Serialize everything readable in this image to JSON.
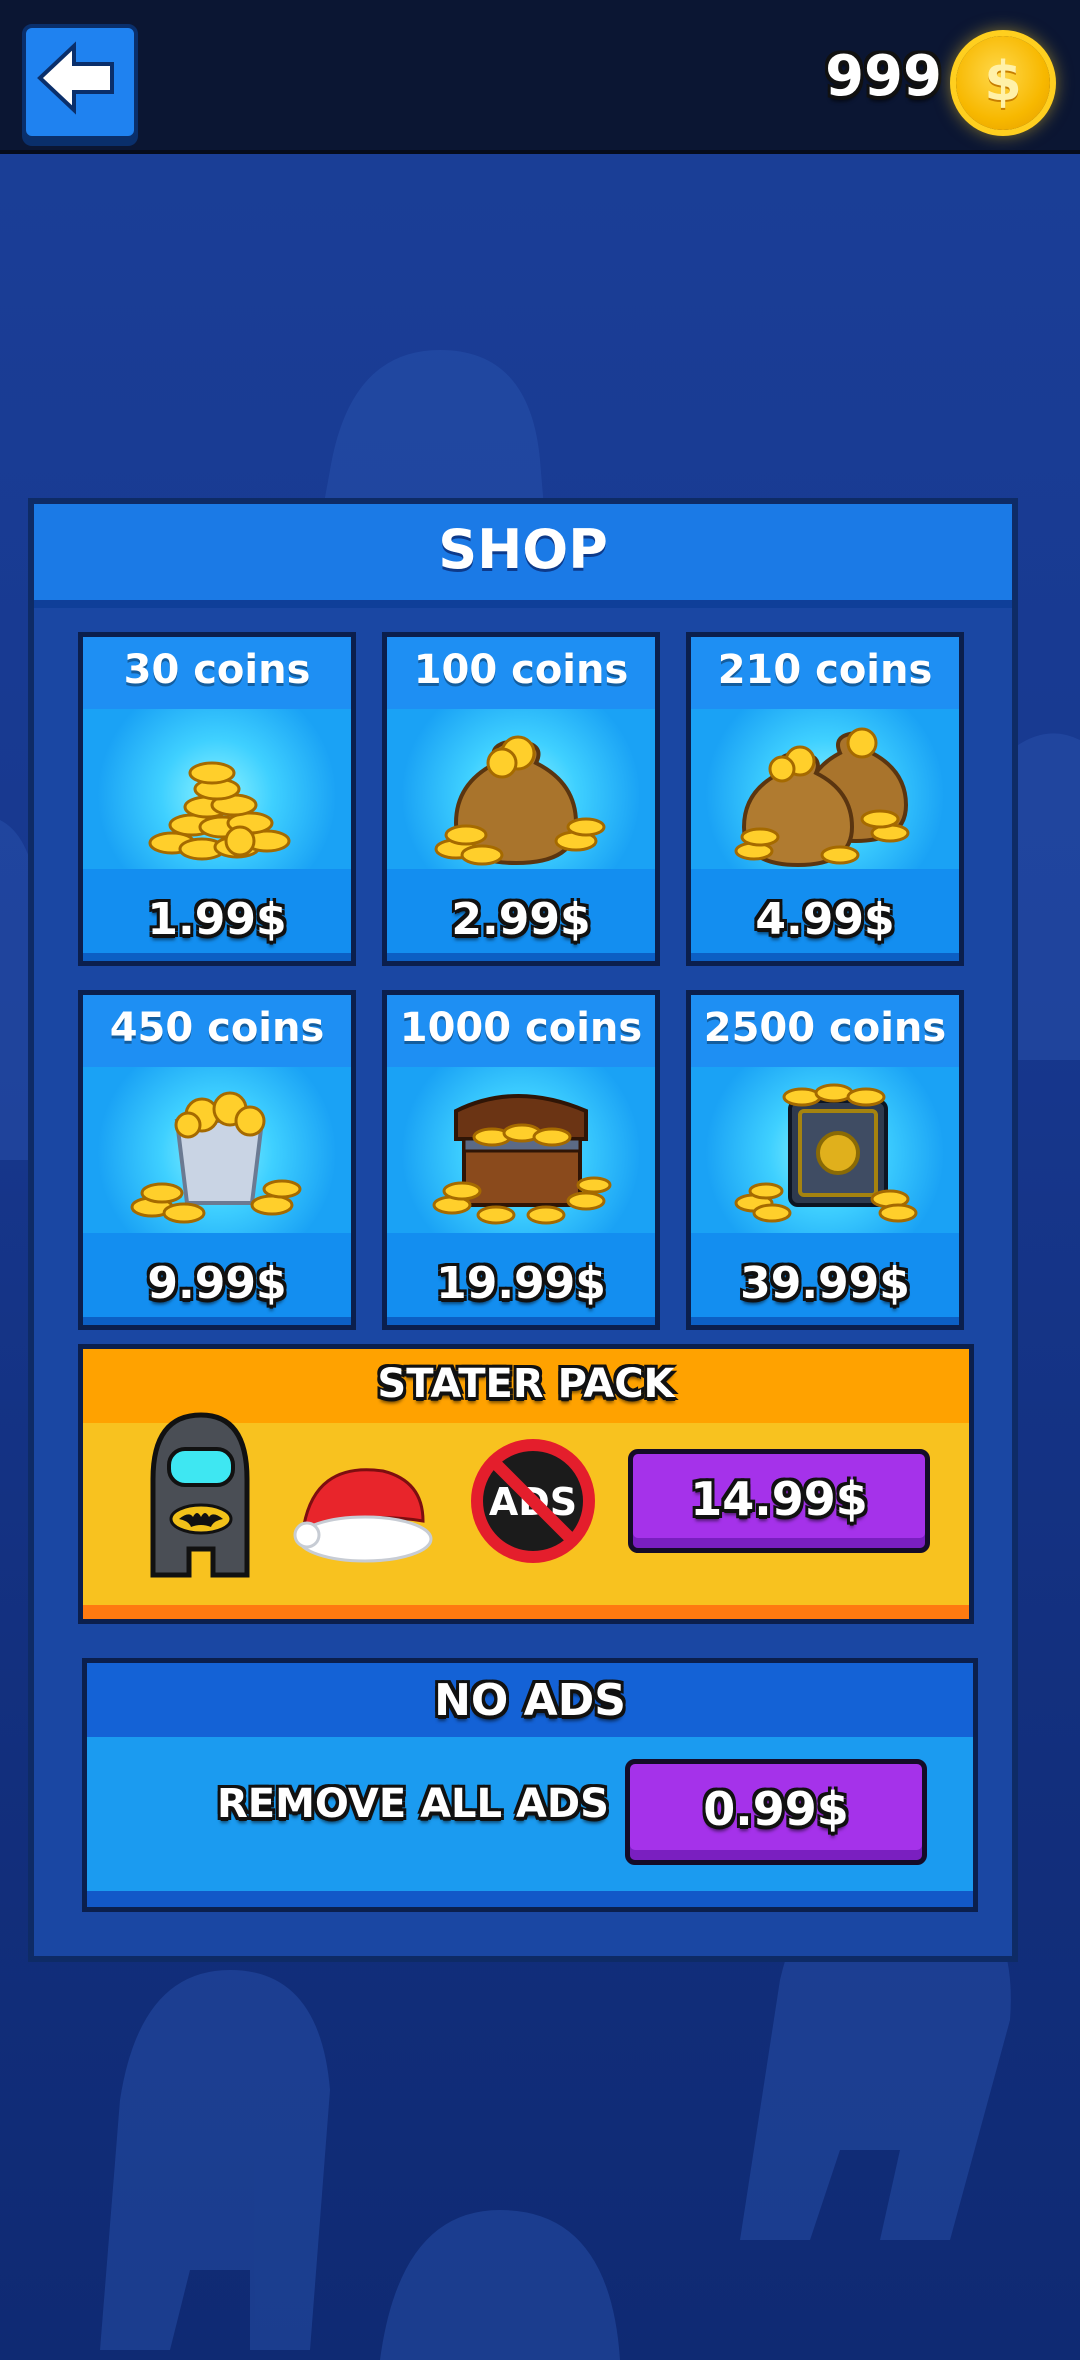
{
  "colors": {
    "background": "#17388f",
    "topbar": "#0b1633",
    "panel": "#1a47a3",
    "panel_header": "#1b7ae6",
    "tile": "#1b88ee",
    "starter_pack": "#f8c21f",
    "buy_button": "#a532ea",
    "coin": "#f7b800"
  },
  "topbar": {
    "back_icon": "arrow-left-icon",
    "coin_balance": "999",
    "coin_icon": "dollar-coin-icon",
    "coin_symbol": "$"
  },
  "shop": {
    "title": "SHOP",
    "packs": [
      {
        "amount": "30 coins",
        "price": "1.99$",
        "icon": "coin-pile-icon"
      },
      {
        "amount": "100 coins",
        "price": "2.99$",
        "icon": "coin-bag-icon"
      },
      {
        "amount": "210 coins",
        "price": "4.99$",
        "icon": "two-coin-bags-icon"
      },
      {
        "amount": "450 coins",
        "price": "9.99$",
        "icon": "coin-bucket-icon"
      },
      {
        "amount": "1000 coins",
        "price": "19.99$",
        "icon": "treasure-chest-icon"
      },
      {
        "amount": "2500 coins",
        "price": "39.99$",
        "icon": "coin-safe-icon"
      }
    ],
    "starter_pack": {
      "title": "STATER PACK",
      "items": [
        "batman-crewmate-skin-icon",
        "santa-hat-icon",
        "no-ads-icon"
      ],
      "no_ads_badge": "ADS",
      "price": "14.99$"
    },
    "no_ads": {
      "title": "NO ADS",
      "label": "REMOVE ALL ADS",
      "price": "0.99$"
    }
  }
}
